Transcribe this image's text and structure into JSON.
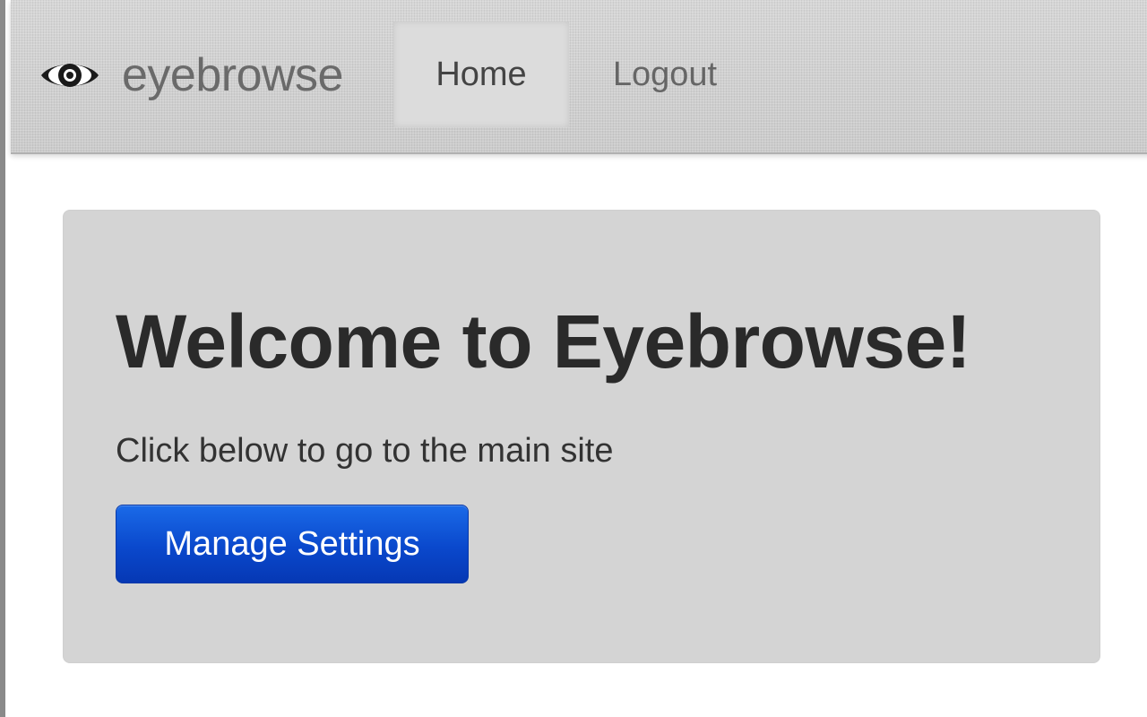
{
  "navbar": {
    "brand_name": "eyebrowse",
    "brand_icon": "eye-icon",
    "items": [
      {
        "label": "Home",
        "active": true
      },
      {
        "label": "Logout",
        "active": false
      }
    ]
  },
  "hero": {
    "title": "Welcome to Eyebrowse!",
    "text": "Click below to go to the main site",
    "button_label": "Manage Settings"
  },
  "colors": {
    "navbar_bg": "#d2d2d2",
    "hero_bg": "#d4d4d4",
    "button_primary": "#0a48cc",
    "title_text": "#2a2a2a"
  }
}
